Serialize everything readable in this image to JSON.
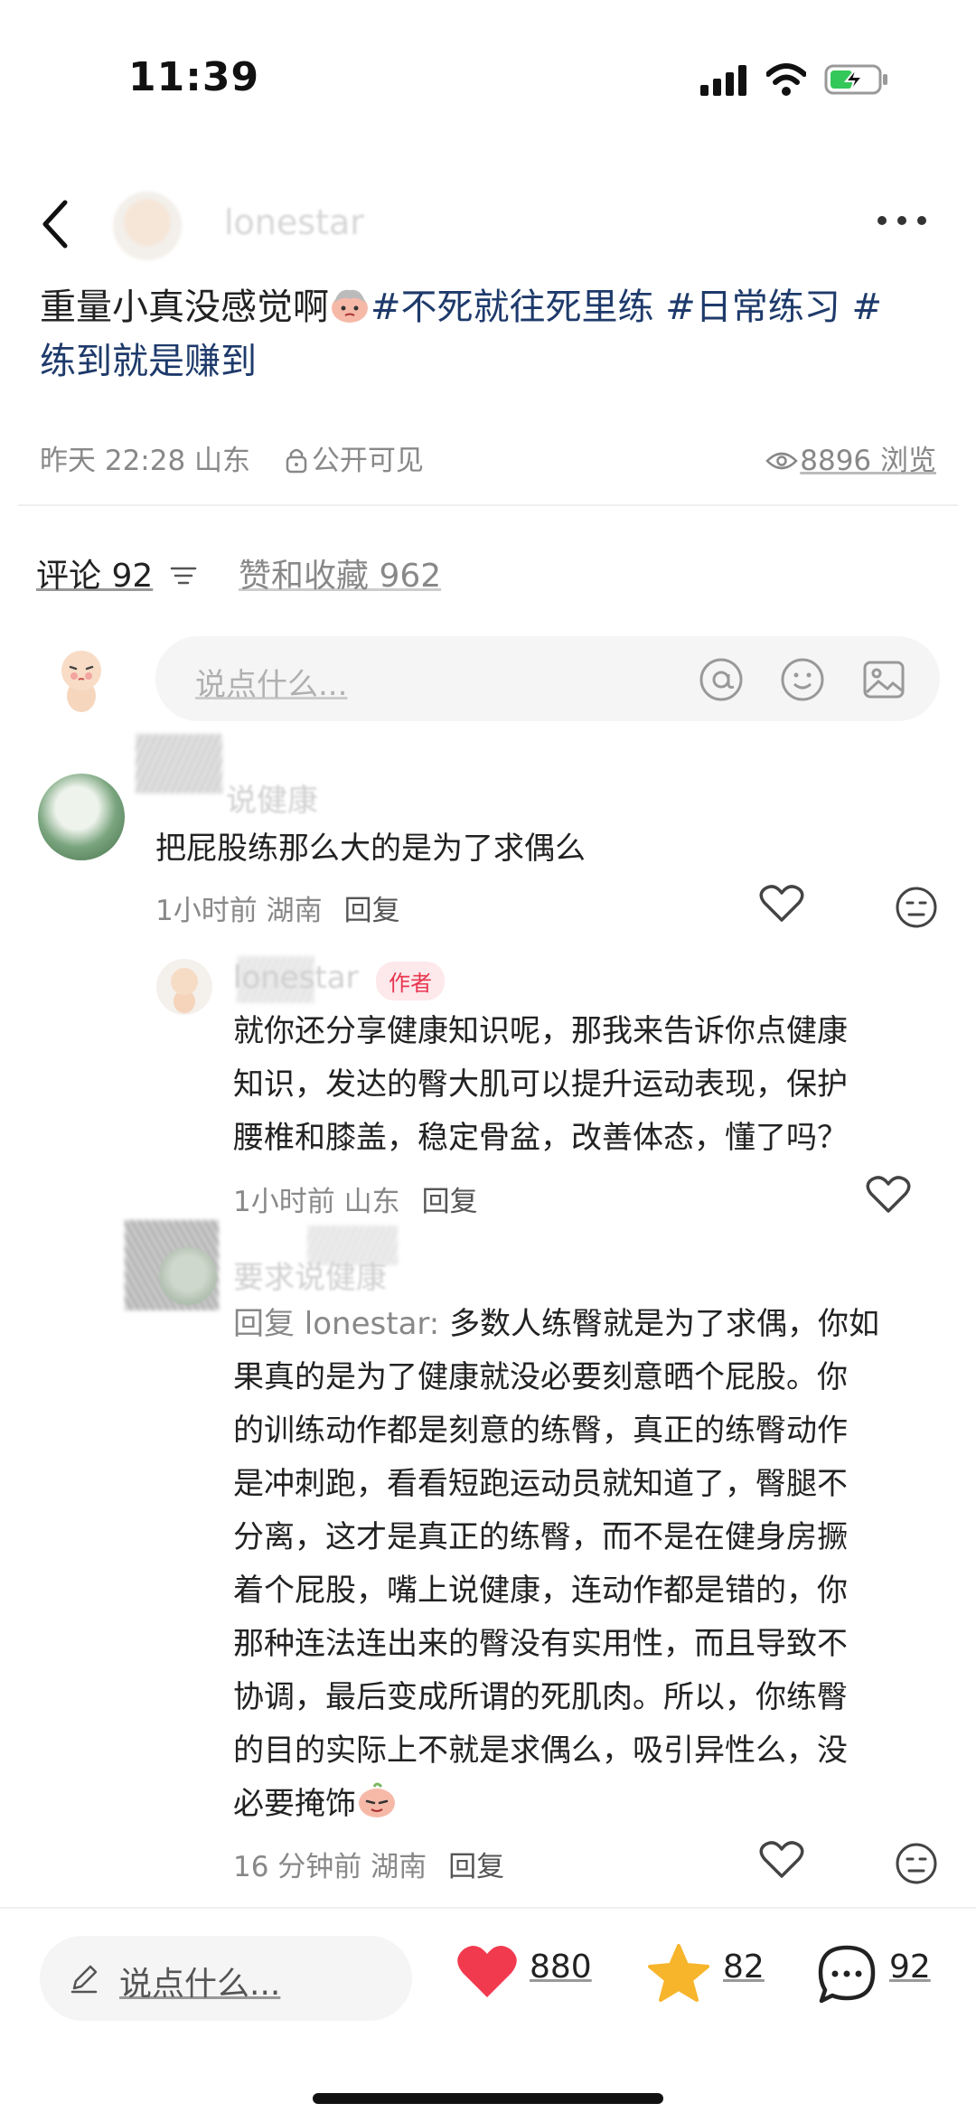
{
  "status_bar": {
    "time": "11:39"
  },
  "header": {
    "author_name": "lonestar"
  },
  "post": {
    "text_before": "重量小真没感觉啊",
    "tags_line1": "#不死就往死里练 #日常练习 #",
    "tags_line2": "练到就是赚到",
    "time_location": "昨天 22:28 山东",
    "visibility": "公开可见",
    "views": "8896 浏览"
  },
  "tabs": {
    "comments": "评论 92",
    "likes_collects": "赞和收藏 962"
  },
  "comment_input": {
    "placeholder": "说点什么..."
  },
  "comments": [
    {
      "author": "说健康",
      "text": "把屁股练那么大的是为了求偶么",
      "meta": "1小时前 湖南",
      "reply": "回复"
    },
    {
      "author": "lonestar",
      "badge": "作者",
      "lines": [
        "就你还分享健康知识呢，那我来告诉你点健康",
        "知识，发达的臀大肌可以提升运动表现，保护",
        "腰椎和膝盖，稳定骨盆，改善体态，懂了吗？"
      ],
      "meta": "1小时前 山东",
      "reply": "回复"
    },
    {
      "author": "要求说健康",
      "reply_prefix": "回复 lonestar:",
      "lines": [
        "多数人练臀就是为了求偶，你如",
        "果真的是为了健康就没必要刻意晒个屁股。你",
        "的训练动作都是刻意的练臀，真正的练臀动作",
        "是冲刺跑，看看短跑运动员就知道了，臀腿不",
        "分离，这才是真正的练臀，而不是在健身房撅",
        "着个屁股，嘴上说健康，连动作都是错的，你",
        "那种连法连出来的臀没有实用性，而且导致不",
        "协调，最后变成所谓的死肌肉。所以，你练臀",
        "的目的实际上不就是求偶么，吸引异性么，没",
        "必要掩饰"
      ],
      "meta": "16 分钟前 湖南",
      "reply": "回复"
    }
  ],
  "bottom_bar": {
    "placeholder": "说点什么...",
    "likes": "880",
    "collects": "82",
    "comments": "92",
    "like_color": "#f23a4f",
    "star_color": "#f7b52c"
  }
}
